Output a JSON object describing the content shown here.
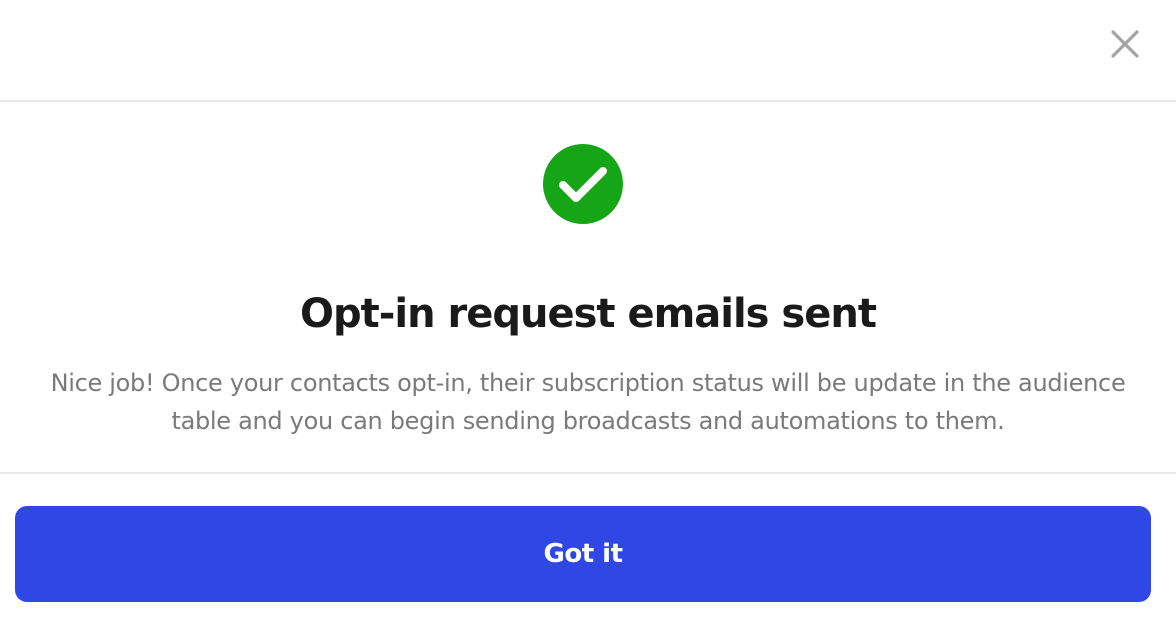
{
  "modal": {
    "title": "Opt-in request emails sent",
    "description": "Nice job! Once your contacts opt-in, their subscription status will be update in the audience table and you can begin sending broadcasts and automations to them.",
    "primary_button_label": "Got it",
    "close_icon": "close-icon",
    "success_icon": "check-circle-icon"
  },
  "colors": {
    "primary": "#2f48e5",
    "success": "#16a516",
    "title": "#1a1a1a",
    "description": "#7a7a7a",
    "close_icon": "#a3a3a3",
    "divider": "#e8e8e8"
  }
}
